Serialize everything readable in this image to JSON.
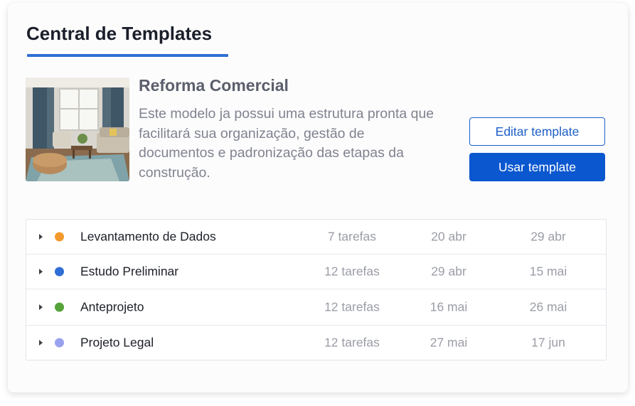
{
  "panel": {
    "title": "Central de Templates"
  },
  "template": {
    "name": "Reforma Comercial",
    "description": "Este modelo ja possui uma estrutura pronta que facilitará sua organização, gestão de documentos e padronização das etapas da construção.",
    "image_icon": "living-room-photo",
    "edit_label": "Editar template",
    "use_label": "Usar template"
  },
  "colors": {
    "accent": "#2f6ed4",
    "primary_button": "#0b57cf"
  },
  "stages": [
    {
      "name": "Levantamento de Dados",
      "color": "#f29a2e",
      "tasks": "7 tarefas",
      "start": "20 abr",
      "end": "29 abr"
    },
    {
      "name": "Estudo Preliminar",
      "color": "#2f6ed4",
      "tasks": "12 tarefas",
      "start": "29 abr",
      "end": "15 mai"
    },
    {
      "name": "Anteprojeto",
      "color": "#56a33b",
      "tasks": "12 tarefas",
      "start": "16 mai",
      "end": "26 mai"
    },
    {
      "name": "Projeto Legal",
      "color": "#9aa2ef",
      "tasks": "12 tarefas",
      "start": "27 mai",
      "end": "17 jun"
    }
  ]
}
